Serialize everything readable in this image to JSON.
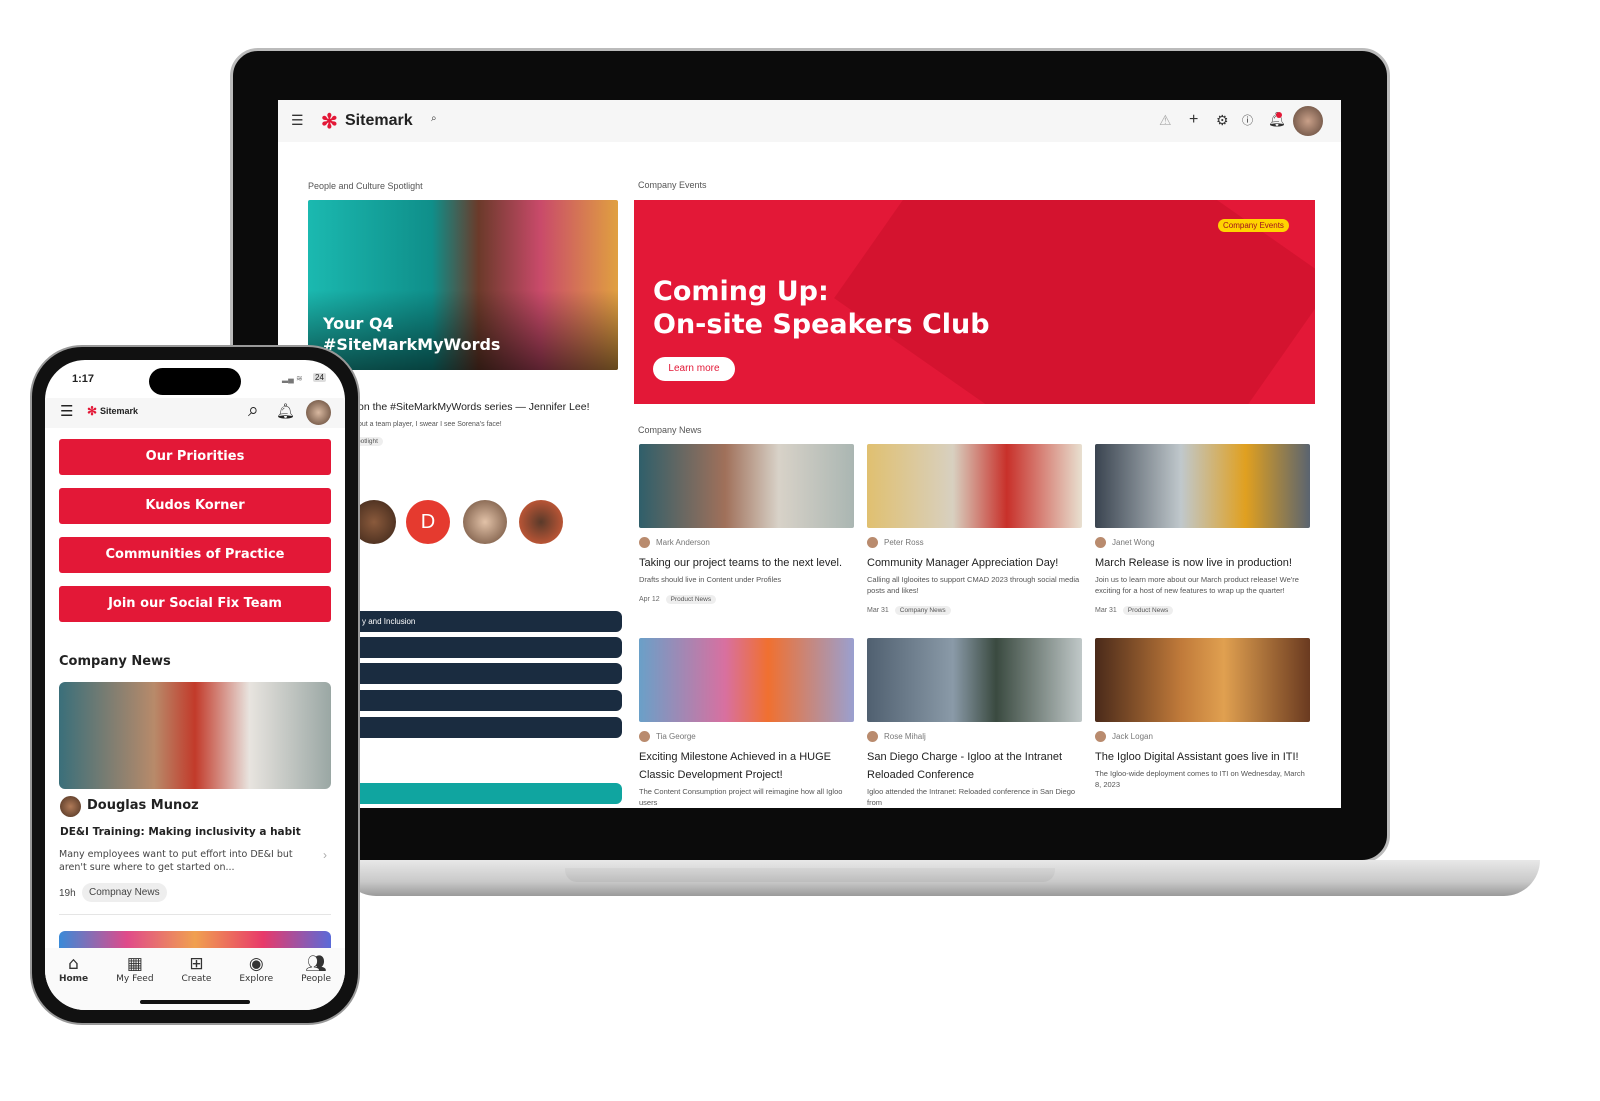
{
  "laptop": {
    "header": {
      "logo": "Sitemark",
      "icons": [
        "menu-icon",
        "search-icon",
        "warning-icon",
        "plus-icon",
        "gear-icon",
        "help-icon",
        "bell-icon",
        "avatar"
      ]
    },
    "spotlight": {
      "section": "People and Culture Spotlight",
      "image_text_1": "Your Q4",
      "image_text_2": "#SiteMarkMyWords",
      "title": "on the #SiteMarkMyWords series — Jennifer Lee!",
      "desc": "out a team player, I swear I see Sorena's face!",
      "tag": "potlight",
      "avatar_letter": "D",
      "bar_label": "y and Inclusion"
    },
    "events": {
      "section": "Company Events",
      "badge": "Company Events",
      "title_1": "Coming Up:",
      "title_2": "On-site Speakers Club",
      "button": "Learn more",
      "color": "#e31837"
    },
    "news": {
      "section": "Company News",
      "cards": [
        {
          "author": "Mark Anderson",
          "title": "Taking our project teams to the next level.",
          "desc": "Drafts should live in Content under Profiles",
          "date": "Apr 12",
          "tag": "Product News"
        },
        {
          "author": "Peter Ross",
          "title": "Community Manager Appreciation Day!",
          "desc": "Calling all Iglooites to support CMAD 2023 through social media posts and likes!",
          "date": "Mar 31",
          "tag": "Company News"
        },
        {
          "author": "Janet Wong",
          "title": "March Release is now live in production!",
          "desc": "Join us to learn more about our March product release! We're exciting for a host of new features to wrap up the quarter!",
          "date": "Mar 31",
          "tag": "Product News"
        },
        {
          "author": "Tia George",
          "title": "Exciting Milestone Achieved in a HUGE Classic Development Project!",
          "desc": "The Content Consumption project will reimagine how all Igloo users"
        },
        {
          "author": "Rose Mihalj",
          "title": "San Diego Charge - Igloo at the Intranet Reloaded Conference",
          "desc": "Igloo attended the Intranet: Reloaded conference in San Diego from"
        },
        {
          "author": "Jack Logan",
          "title": "The Igloo Digital Assistant goes live in ITI!",
          "desc": "The Igloo-wide deployment comes to ITI on Wednesday, March 8, 2023"
        }
      ]
    }
  },
  "phone": {
    "time": "1:17",
    "battery": "24",
    "logo": "Sitemark",
    "buttons": [
      "Our Priorities",
      "Kudos Korner",
      "Communities of Practice",
      "Join our Social Fix Team"
    ],
    "news_heading": "Company News",
    "post": {
      "author": "Douglas Munoz",
      "title": "DE&I Training: Making inclusivity a habit",
      "desc": "Many employees want to put effort into DE&I but aren't sure where to get started on...",
      "time": "19h",
      "tag": "Compnay News"
    },
    "nav": [
      {
        "label": "Home",
        "icon": "home-icon"
      },
      {
        "label": "My Feed",
        "icon": "grid-icon"
      },
      {
        "label": "Create",
        "icon": "plus-square-icon"
      },
      {
        "label": "Explore",
        "icon": "compass-icon"
      },
      {
        "label": "People",
        "icon": "people-icon"
      }
    ]
  }
}
